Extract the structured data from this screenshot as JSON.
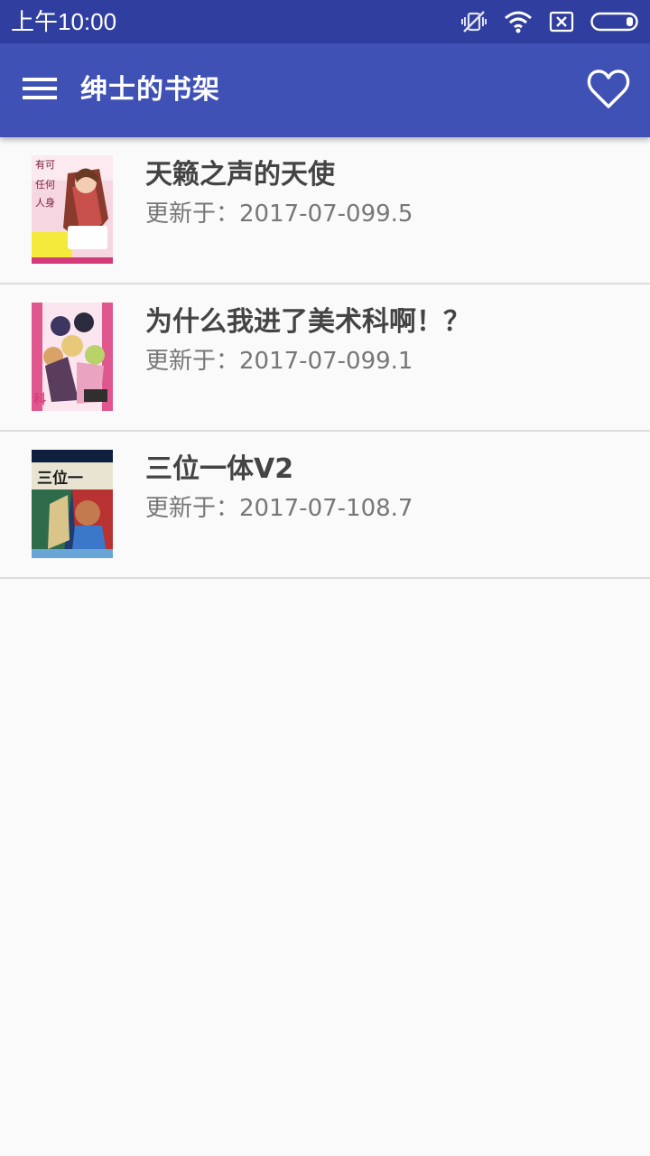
{
  "status_bar": {
    "time": "上午10:00",
    "icons": [
      "vibrate-off-icon",
      "wifi-icon",
      "sim-x-icon",
      "battery-icon"
    ]
  },
  "app_bar": {
    "title": "绅士的书架",
    "left_icon": "menu-icon",
    "right_icon": "heart-outline-icon"
  },
  "books": [
    {
      "title": "天籁之声的天使",
      "update_label": "更新于：",
      "update_value": "2017-07-099.5"
    },
    {
      "title": "为什么我进了美术科啊！？",
      "update_label": "更新于：",
      "update_value": "2017-07-099.1"
    },
    {
      "title": "三位一体V2",
      "update_label": "更新于：",
      "update_value": "2017-07-108.7"
    }
  ],
  "colors": {
    "status_bar": "#303f9f",
    "app_bar": "#3f51b5",
    "background": "#fafafa",
    "title_text": "#444444",
    "secondary_text": "#777777",
    "divider": "#dcdcdc"
  }
}
